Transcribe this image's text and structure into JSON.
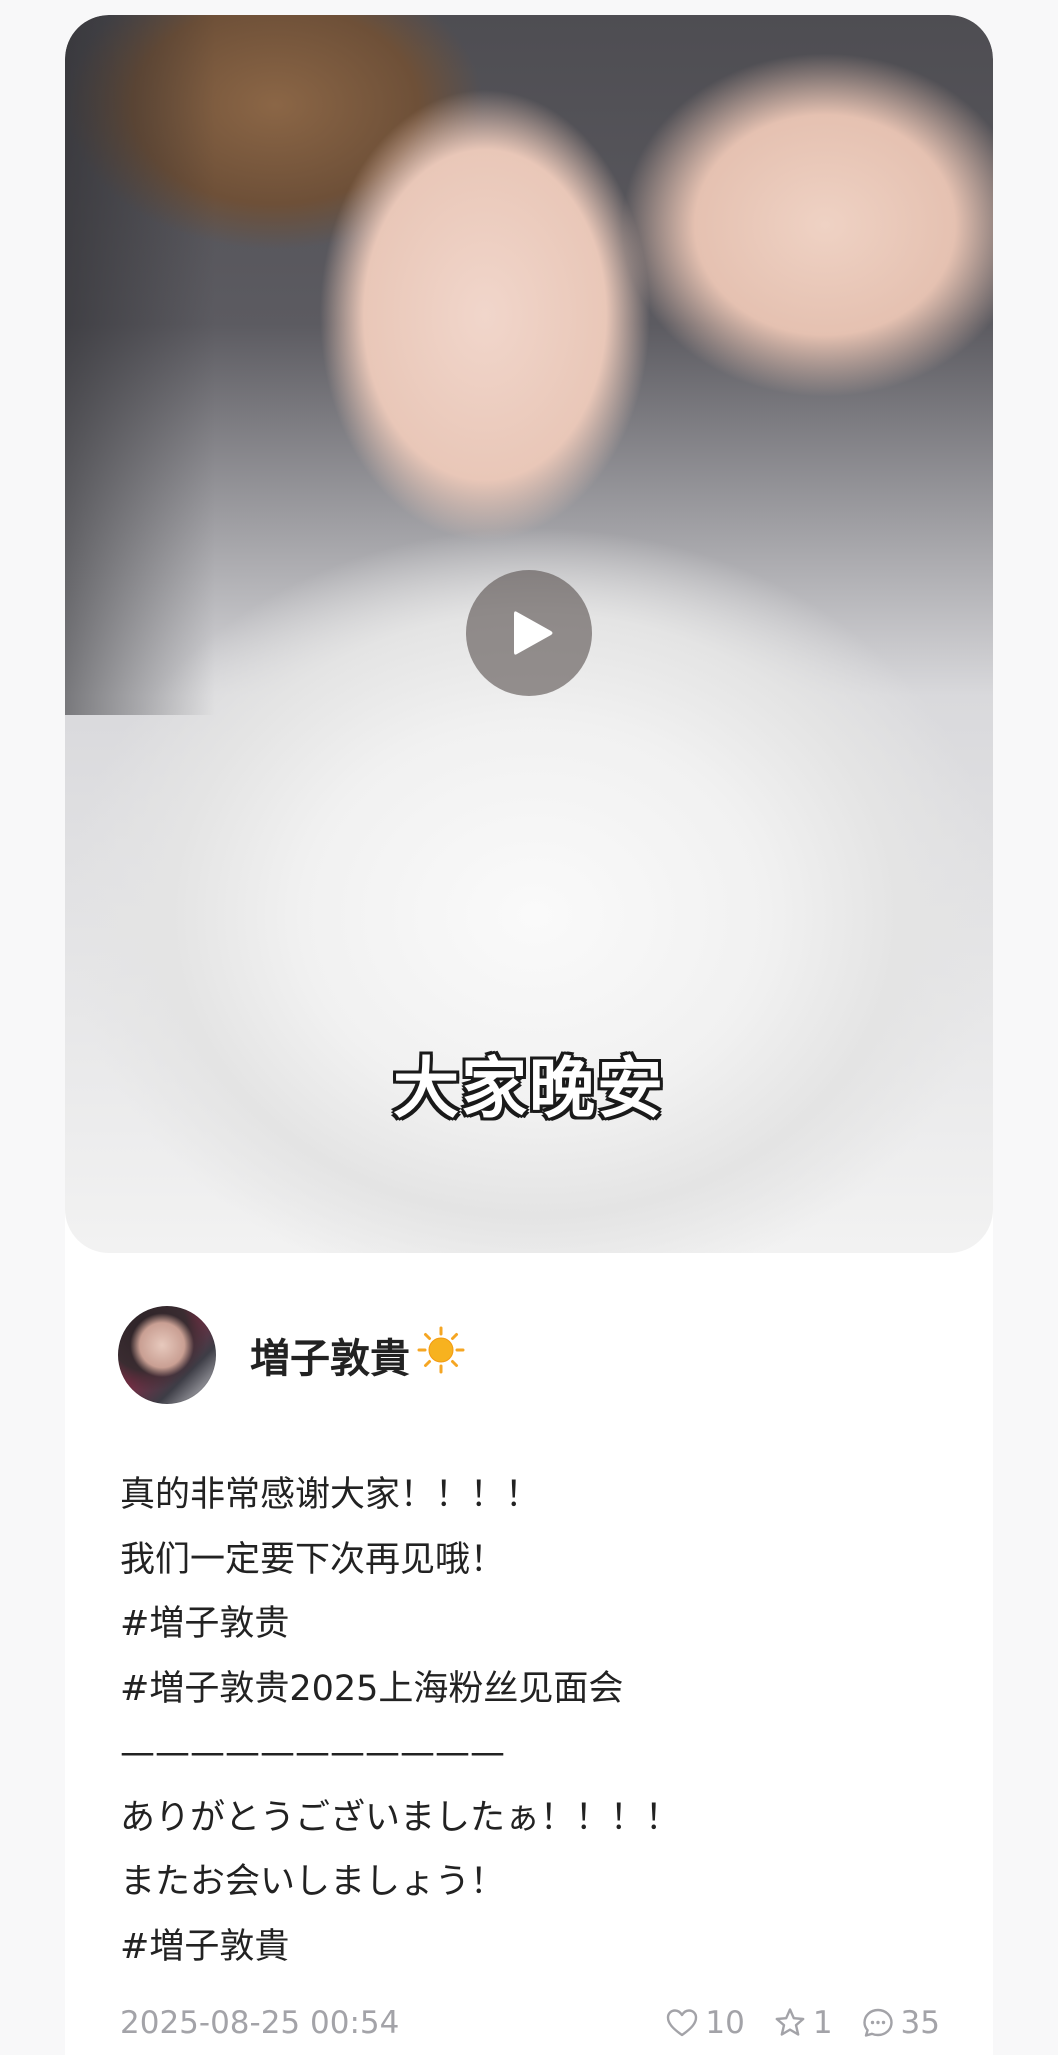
{
  "media": {
    "caption": "大家晚安",
    "play_icon": "play-icon"
  },
  "author": {
    "name": "増子敦貴",
    "badge_icon": "sun-icon"
  },
  "post": {
    "lines": [
      "真的非常感谢大家！！！！",
      "我们一定要下次再见哦！",
      "#増子敦贵",
      "#増子敦贵2025上海粉丝见面会",
      "———————————",
      "ありがとうございましたぁ！！！！",
      "またお会いしましょう！",
      "#増子敦貴"
    ]
  },
  "meta": {
    "timestamp": "2025-08-25 00:54",
    "likes": "10",
    "favorites": "1",
    "comments": "35"
  },
  "colors": {
    "background": "#f8f8f9",
    "card": "#ffffff",
    "text": "#222222",
    "muted": "#a3a3a8",
    "sun": "#f5a623"
  }
}
